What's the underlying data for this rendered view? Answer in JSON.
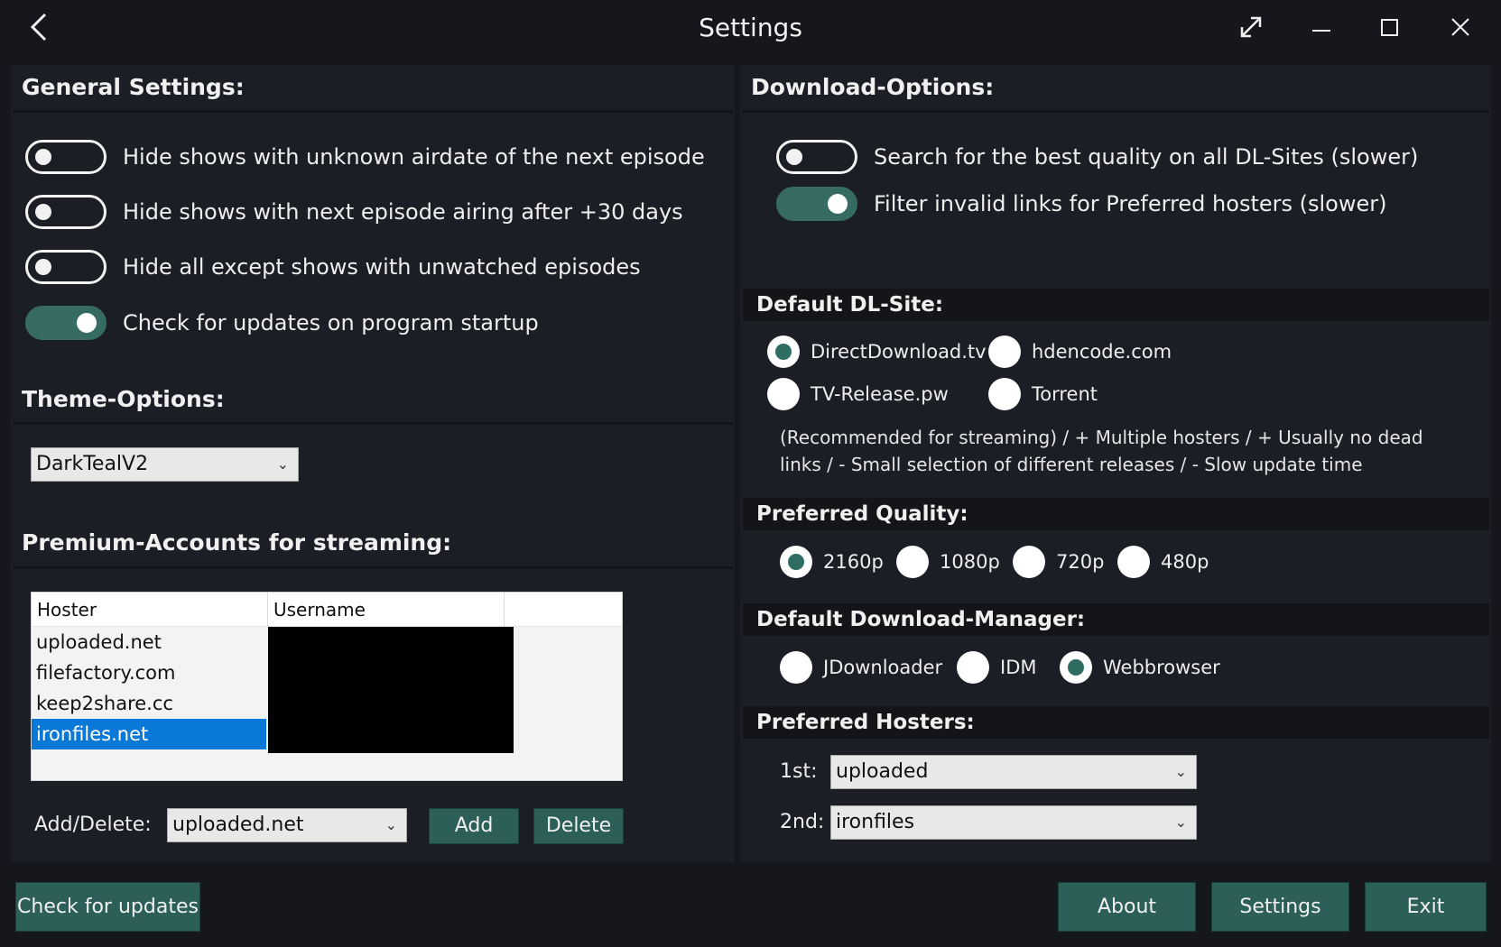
{
  "window": {
    "title": "Settings"
  },
  "general": {
    "heading": "General Settings:",
    "toggles": [
      {
        "label": "Hide shows with unknown airdate of the next episode",
        "on": false
      },
      {
        "label": "Hide shows with next episode airing after +30 days",
        "on": false
      },
      {
        "label": "Hide all except shows with unwatched episodes",
        "on": false
      },
      {
        "label": "Check for updates on program startup",
        "on": true
      }
    ]
  },
  "theme": {
    "heading": "Theme-Options:",
    "selected": "DarkTealV2"
  },
  "premium": {
    "heading": "Premium-Accounts for streaming:",
    "columns": [
      "Hoster",
      "Username"
    ],
    "rows": [
      "uploaded.net",
      "filefactory.com",
      "keep2share.cc",
      "ironfiles.net"
    ],
    "selected_row": 3,
    "add_delete_label": "Add/Delete:",
    "add_delete_selected": "uploaded.net",
    "add_label": "Add",
    "delete_label": "Delete"
  },
  "download": {
    "heading": "Download-Options:",
    "toggles": [
      {
        "label": "Search for the best quality on all DL-Sites (slower)",
        "on": false
      },
      {
        "label": "Filter invalid links for Preferred hosters (slower)",
        "on": true
      }
    ]
  },
  "dl_site": {
    "heading": "Default DL-Site:",
    "options": [
      "DirectDownload.tv",
      "hdencode.com",
      "TV-Release.pw",
      "Torrent"
    ],
    "selected": "DirectDownload.tv",
    "description": "(Recommended for streaming) / + Multiple hosters / + Usually no dead links / - Small selection of different releases / - Slow update time"
  },
  "quality": {
    "heading": "Preferred Quality:",
    "options": [
      "2160p",
      "1080p",
      "720p",
      "480p"
    ],
    "selected": "2160p"
  },
  "manager": {
    "heading": "Default Download-Manager:",
    "options": [
      "JDownloader",
      "IDM",
      "Webbrowser"
    ],
    "selected": "Webbrowser"
  },
  "hosters": {
    "heading": "Preferred Hosters:",
    "first_label": "1st:",
    "first_value": "uploaded",
    "second_label": "2nd:",
    "second_value": "ironfiles"
  },
  "footer": {
    "check_updates": "Check for updates",
    "about": "About",
    "settings": "Settings",
    "exit": "Exit"
  },
  "colors": {
    "accent": "#2c5f57",
    "toggle_on": "#356b63",
    "selection": "#0a78d7",
    "background": "#15171c"
  }
}
